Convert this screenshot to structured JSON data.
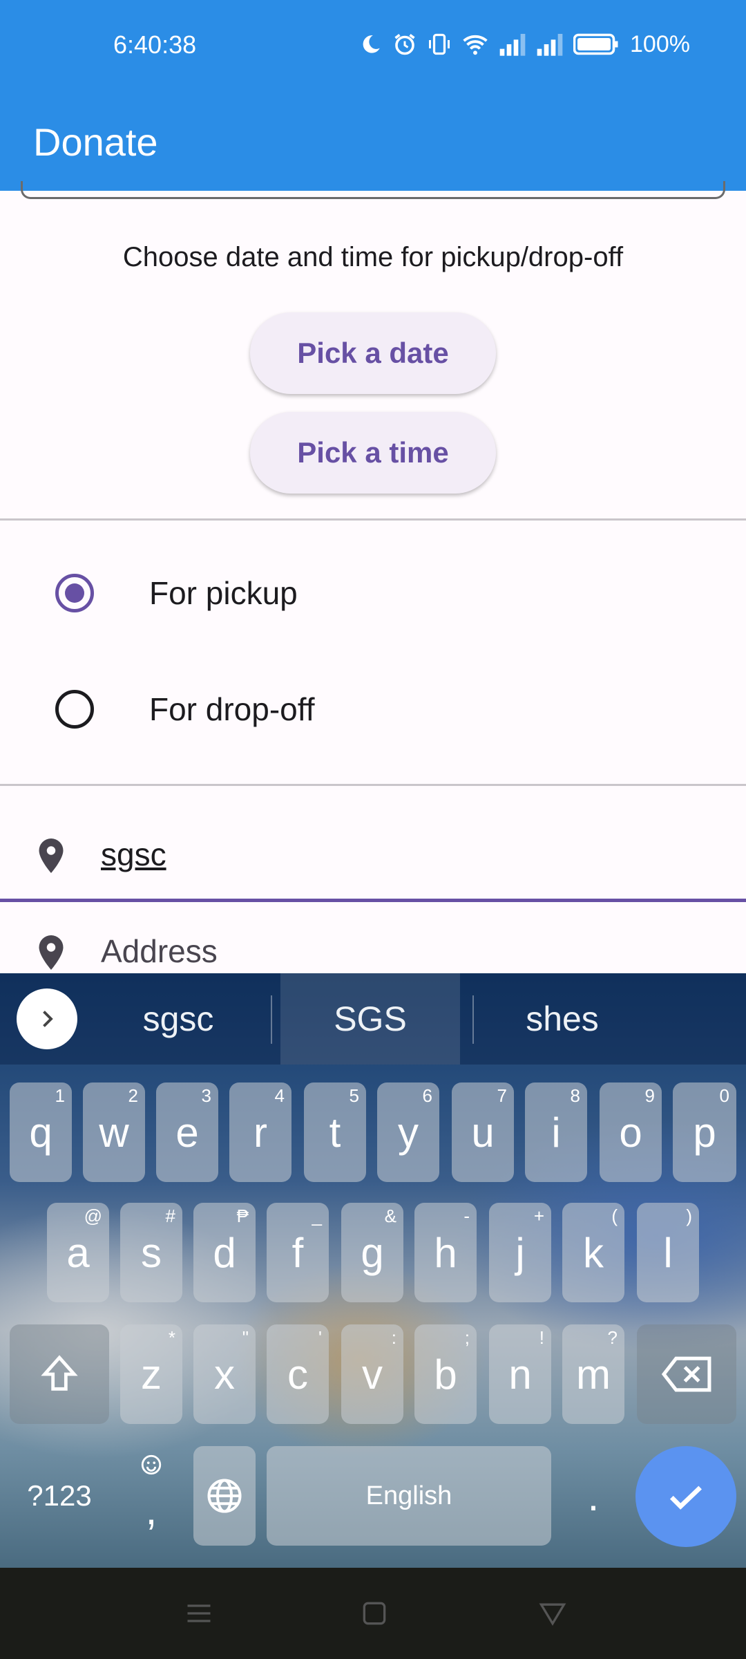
{
  "status_bar": {
    "time": "6:40:38",
    "battery": "100%",
    "icons": [
      "moon-icon",
      "alarm-icon",
      "vibrate-icon",
      "wifi-icon",
      "signal-icon",
      "signal-icon",
      "battery-icon"
    ]
  },
  "app_bar": {
    "title": "Donate"
  },
  "schedule": {
    "title": "Choose date and time for pickup/drop-off",
    "pick_date_label": "Pick a date",
    "pick_time_label": "Pick a time"
  },
  "delivery_options": [
    {
      "label": "For pickup",
      "selected": true
    },
    {
      "label": "For drop-off",
      "selected": false
    }
  ],
  "location_fields": {
    "location_value": "sgsc",
    "address_placeholder": "Address"
  },
  "keyboard": {
    "suggestions": [
      "sgsc",
      "SGS",
      "shes"
    ],
    "row1": [
      {
        "k": "q",
        "h": "1"
      },
      {
        "k": "w",
        "h": "2"
      },
      {
        "k": "e",
        "h": "3"
      },
      {
        "k": "r",
        "h": "4"
      },
      {
        "k": "t",
        "h": "5"
      },
      {
        "k": "y",
        "h": "6"
      },
      {
        "k": "u",
        "h": "7"
      },
      {
        "k": "i",
        "h": "8"
      },
      {
        "k": "o",
        "h": "9"
      },
      {
        "k": "p",
        "h": "0"
      }
    ],
    "row2": [
      {
        "k": "a",
        "h": "@"
      },
      {
        "k": "s",
        "h": "#"
      },
      {
        "k": "d",
        "h": "₱"
      },
      {
        "k": "f",
        "h": "_"
      },
      {
        "k": "g",
        "h": "&"
      },
      {
        "k": "h",
        "h": "-"
      },
      {
        "k": "j",
        "h": "+"
      },
      {
        "k": "k",
        "h": "("
      },
      {
        "k": "l",
        "h": ")"
      }
    ],
    "row3": [
      {
        "k": "z",
        "h": "*"
      },
      {
        "k": "x",
        "h": "\""
      },
      {
        "k": "c",
        "h": "'"
      },
      {
        "k": "v",
        "h": ":"
      },
      {
        "k": "b",
        "h": ";"
      },
      {
        "k": "n",
        "h": "!"
      },
      {
        "k": "m",
        "h": "?"
      }
    ],
    "symbols_key": "?123",
    "comma_key": ",",
    "space_label": "English",
    "period_key": "."
  },
  "colors": {
    "app_bar": "#2b8de6",
    "accent": "#6750a4",
    "enter_key": "#5b93f0"
  }
}
